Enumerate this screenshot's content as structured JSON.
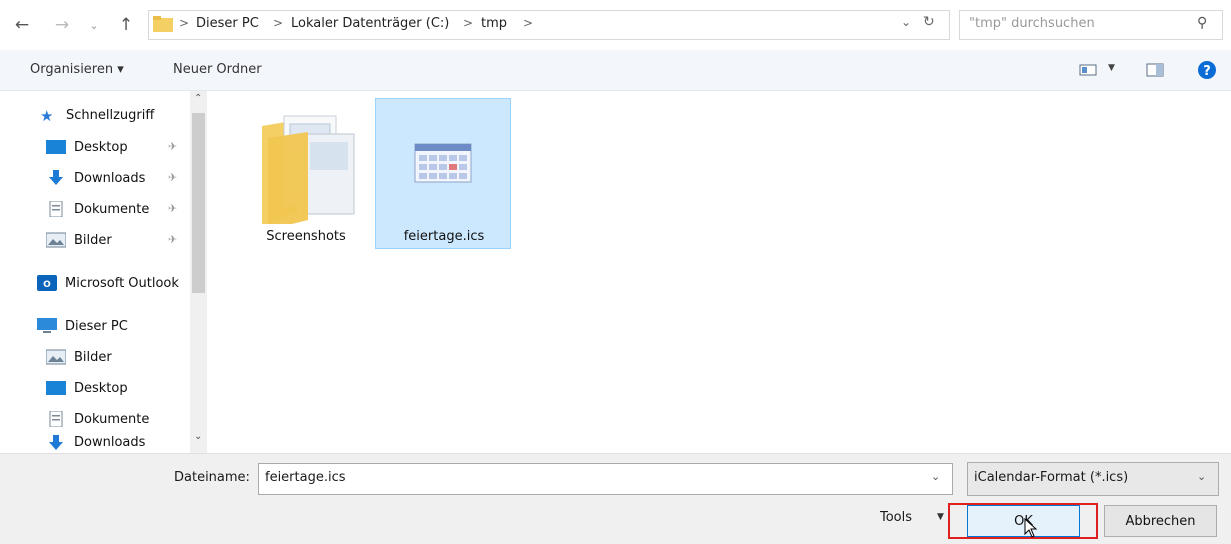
{
  "address": {
    "breadcrumbs": [
      "Dieser PC",
      "Lokaler Datenträger (C:)",
      "tmp"
    ],
    "search_placeholder": "\"tmp\" durchsuchen"
  },
  "toolbar": {
    "organize_label": "Organisieren ▾",
    "new_folder_label": "Neuer Ordner"
  },
  "nav": {
    "quick_access": "Schnellzugriff",
    "quick_items": [
      "Desktop",
      "Downloads",
      "Dokumente",
      "Bilder"
    ],
    "outlook": "Microsoft Outlook",
    "this_pc": "Dieser PC",
    "pc_items": [
      "Bilder",
      "Desktop",
      "Dokumente",
      "Downloads"
    ]
  },
  "files": [
    {
      "name": "Screenshots",
      "icon": "folder-icon",
      "selected": false
    },
    {
      "name": "feiertage.ics",
      "icon": "calendar-file-icon",
      "selected": true
    }
  ],
  "footer": {
    "filename_label": "Dateiname:",
    "filename_value": "feiertage.ics",
    "filetype_value": "iCalendar-Format (*.ics)",
    "tools_label": "Tools",
    "ok_label": "OK",
    "cancel_label": "Abbrechen"
  },
  "colors": {
    "selection": "#cce8ff",
    "highlight_border": "#e0201e",
    "folder": "#f6d46b",
    "accent": "#0078d7"
  }
}
